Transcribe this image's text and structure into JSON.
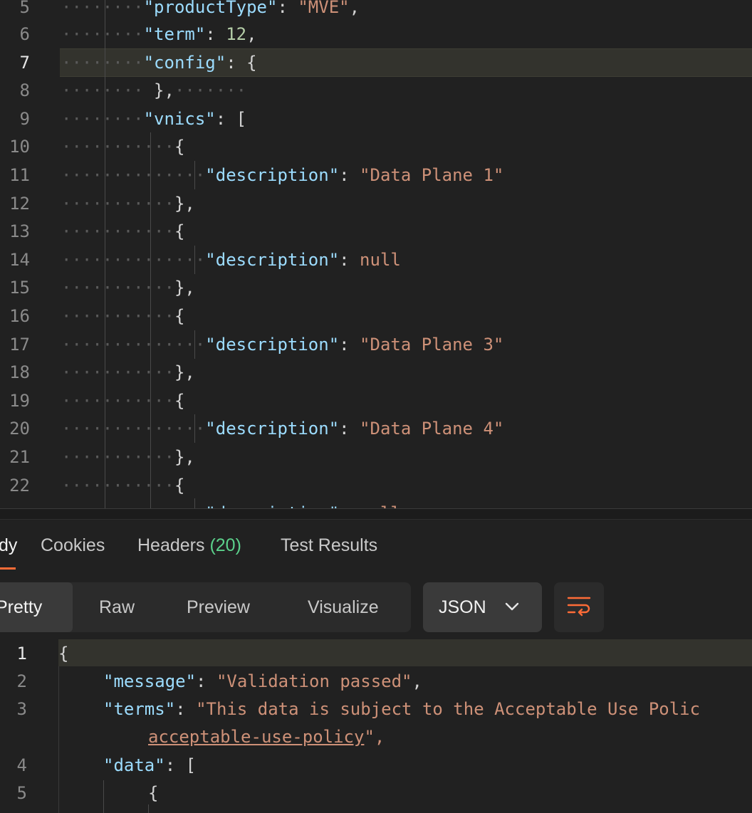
{
  "editor": {
    "line_numbers": [
      "5",
      "6",
      "7",
      "8",
      "9",
      "10",
      "11",
      "12",
      "13",
      "14",
      "15",
      "16",
      "17",
      "18",
      "19",
      "20",
      "21",
      "22"
    ],
    "active_line": "7",
    "lines": {
      "l5": {
        "key": "\"productType\"",
        "sep": ": ",
        "val": "\"MVE\"",
        "end": ","
      },
      "l6": {
        "key": "\"term\"",
        "sep": ": ",
        "val": "12",
        "end": ","
      },
      "l7": {
        "key": "\"config\"",
        "sep": ": ",
        "val": "{"
      },
      "l8": {
        "text": "},"
      },
      "l9": {
        "key": "\"vnics\"",
        "sep": ": ",
        "val": "["
      },
      "l10": {
        "text": "{"
      },
      "l11": {
        "key": "\"description\"",
        "sep": ": ",
        "val": "\"Data Plane 1\""
      },
      "l12": {
        "text": "},"
      },
      "l13": {
        "text": "{"
      },
      "l14": {
        "key": "\"description\"",
        "sep": ": ",
        "val": "null"
      },
      "l15": {
        "text": "},"
      },
      "l16": {
        "text": "{"
      },
      "l17": {
        "key": "\"description\"",
        "sep": ": ",
        "val": "\"Data Plane 3\""
      },
      "l18": {
        "text": "},"
      },
      "l19": {
        "text": "{"
      },
      "l20": {
        "key": "\"description\"",
        "sep": ": ",
        "val": "\"Data Plane 4\""
      },
      "l21": {
        "text": "},"
      },
      "l22": {
        "text": "{"
      },
      "l23": {
        "key": "\"description\"",
        "sep": ": ",
        "val": "null"
      }
    }
  },
  "tabs": {
    "body": "dy",
    "cookies": "Cookies",
    "headers": "Headers",
    "headers_count": "(20)",
    "tests": "Test Results"
  },
  "toolbar": {
    "pretty": "Pretty",
    "raw": "Raw",
    "preview": "Preview",
    "visualize": "Visualize",
    "format": "JSON",
    "wrap_icon": "wrap-lines-icon"
  },
  "response": {
    "line_numbers": [
      "1",
      "2",
      "3",
      "",
      "4",
      "5"
    ],
    "lines": {
      "r1": "{",
      "r2_key": "\"message\"",
      "r2_val": "\"Validation passed\"",
      "r3_key": "\"terms\"",
      "r3_val": "\"This data is subject to the Acceptable Use Polic",
      "r3b_link": "acceptable-use-policy",
      "r3b_end": "\",",
      "r4_key": "\"data\"",
      "r4_val": "[",
      "r5": "{"
    }
  },
  "colors": {
    "accent": "#ff6c37",
    "count_green": "#5bd18b",
    "key": "#9cdcfe",
    "string": "#ce9178",
    "number": "#b5cea8"
  }
}
